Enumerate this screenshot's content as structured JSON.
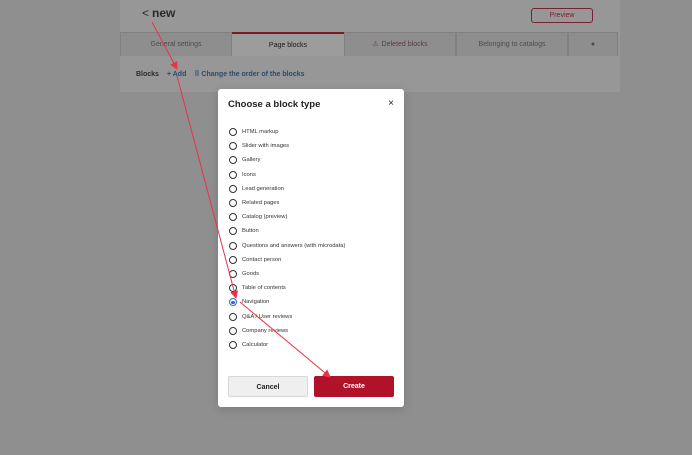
{
  "page": {
    "back_chevron": "<",
    "title": "new",
    "preview_label": "Preview"
  },
  "tabs": [
    {
      "label": "General settings"
    },
    {
      "label": "Page blocks"
    },
    {
      "label": "Deleted blocks"
    },
    {
      "label": "Belonging to catalogs"
    }
  ],
  "blocks_bar": {
    "label": "Blocks",
    "add_label": "+ Add",
    "order_label": "⠿ Change the order of the blocks"
  },
  "modal": {
    "title": "Choose a block type",
    "close": "×",
    "options": [
      {
        "label": "HTML markup",
        "selected": false
      },
      {
        "label": "Slider with images",
        "selected": false
      },
      {
        "label": "Gallery",
        "selected": false
      },
      {
        "label": "Icons",
        "selected": false
      },
      {
        "label": "Lead generation",
        "selected": false
      },
      {
        "label": "Related pages",
        "selected": false
      },
      {
        "label": "Catalog (preview)",
        "selected": false
      },
      {
        "label": "Button",
        "selected": false
      },
      {
        "label": "Questions and answers (with microdata)",
        "selected": false
      },
      {
        "label": "Contact person",
        "selected": false
      },
      {
        "label": "Goods",
        "selected": false
      },
      {
        "label": "Table of contents",
        "selected": false
      },
      {
        "label": "Navigation",
        "selected": true
      },
      {
        "label": "Q&A / User reviews",
        "selected": false
      },
      {
        "label": "Company reviews",
        "selected": false
      },
      {
        "label": "Calculator",
        "selected": false
      }
    ],
    "cancel_label": "Cancel",
    "create_label": "Create"
  },
  "colors": {
    "accent": "#b01329",
    "radio_selected": "#2a6bd9",
    "annotation_arrow": "#e8334a"
  }
}
